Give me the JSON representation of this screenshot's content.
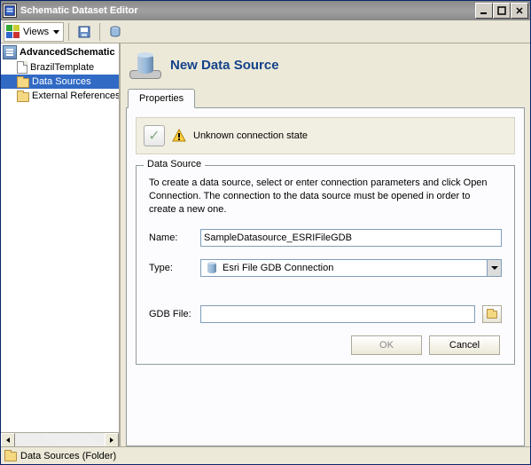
{
  "window": {
    "title": "Schematic Dataset Editor"
  },
  "toolbar": {
    "views_label": "Views"
  },
  "tree": {
    "root": "AdvancedSchematic",
    "items": [
      {
        "label": "BrazilTemplate"
      },
      {
        "label": "Data Sources"
      },
      {
        "label": "External References"
      }
    ]
  },
  "header": {
    "title": "New Data Source"
  },
  "tabs": {
    "properties": "Properties"
  },
  "status": {
    "text": "Unknown connection state"
  },
  "datasource": {
    "legend": "Data Source",
    "description": "To create a data source, select or enter connection parameters and click Open Connection.  The connection to the data source must be opened in order to create a new one.",
    "name_label": "Name:",
    "name_value": "SampleDatasource_ESRIFileGDB",
    "type_label": "Type:",
    "type_value": "Esri File GDB Connection",
    "gdbfile_label": "GDB File:",
    "gdbfile_value": "",
    "ok": "OK",
    "cancel": "Cancel"
  },
  "statusbar": {
    "text": "Data Sources (Folder)"
  }
}
